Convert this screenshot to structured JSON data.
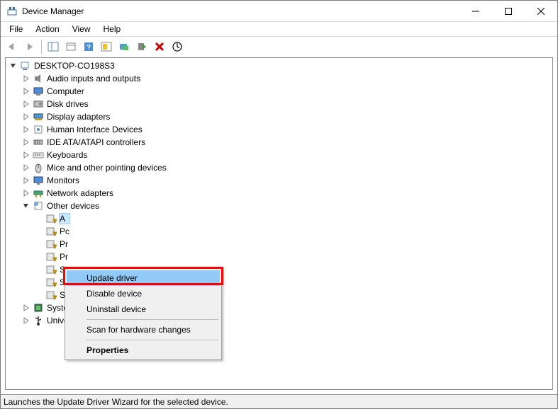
{
  "titlebar": {
    "title": "Device Manager"
  },
  "menubar": {
    "items": [
      "File",
      "Action",
      "View",
      "Help"
    ]
  },
  "toolbar": {
    "buttons": [
      {
        "name": "back-icon"
      },
      {
        "name": "forward-icon"
      },
      {
        "sep": true
      },
      {
        "name": "show-hide-console-tree-icon"
      },
      {
        "name": "properties-icon"
      },
      {
        "name": "help-icon"
      },
      {
        "name": "scan-hardware-icon"
      },
      {
        "name": "update-driver-icon"
      },
      {
        "name": "enable-device-icon"
      },
      {
        "name": "uninstall-icon"
      },
      {
        "name": "scan-action-icon"
      }
    ]
  },
  "tree": {
    "root": {
      "label": "DESKTOP-CO198S3",
      "icon": "computer-root-icon",
      "expanded": true
    },
    "categories": [
      {
        "label": "Audio inputs and outputs",
        "icon": "audio-icon",
        "expanded": false
      },
      {
        "label": "Computer",
        "icon": "computer-icon",
        "expanded": false
      },
      {
        "label": "Disk drives",
        "icon": "disk-icon",
        "expanded": false
      },
      {
        "label": "Display adapters",
        "icon": "display-adapter-icon",
        "expanded": false
      },
      {
        "label": "Human Interface Devices",
        "icon": "hid-icon",
        "expanded": false
      },
      {
        "label": "IDE ATA/ATAPI controllers",
        "icon": "ide-icon",
        "expanded": false
      },
      {
        "label": "Keyboards",
        "icon": "keyboard-icon",
        "expanded": false
      },
      {
        "label": "Mice and other pointing devices",
        "icon": "mouse-icon",
        "expanded": false
      },
      {
        "label": "Monitors",
        "icon": "monitor-icon",
        "expanded": false
      },
      {
        "label": "Network adapters",
        "icon": "network-icon",
        "expanded": false
      },
      {
        "label": "Other devices",
        "icon": "other-devices-icon",
        "expanded": true,
        "children": [
          {
            "label": "A",
            "icon": "unknown-device-icon"
          },
          {
            "label": "Pc",
            "icon": "unknown-device-icon"
          },
          {
            "label": "Pr",
            "icon": "unknown-device-icon"
          },
          {
            "label": "Pr",
            "icon": "unknown-device-icon"
          },
          {
            "label": "So",
            "icon": "unknown-device-icon"
          },
          {
            "label": "So",
            "icon": "unknown-device-icon"
          },
          {
            "label": "St",
            "icon": "unknown-device-icon"
          }
        ]
      },
      {
        "label": "System devices",
        "icon": "system-icon",
        "expanded": false
      },
      {
        "label": "Universal Serial Bus controllers",
        "icon": "usb-icon",
        "expanded": false
      }
    ]
  },
  "context_menu": {
    "items": [
      {
        "label": "Update driver",
        "highlight": true
      },
      {
        "label": "Disable device"
      },
      {
        "label": "Uninstall device"
      },
      {
        "sep": true
      },
      {
        "label": "Scan for hardware changes"
      },
      {
        "sep": true
      },
      {
        "label": "Properties",
        "bold": true
      }
    ]
  },
  "statusbar": {
    "text": "Launches the Update Driver Wizard for the selected device."
  },
  "colors": {
    "highlight_border": "#ff0000",
    "menu_highlight": "#91c9f7"
  }
}
